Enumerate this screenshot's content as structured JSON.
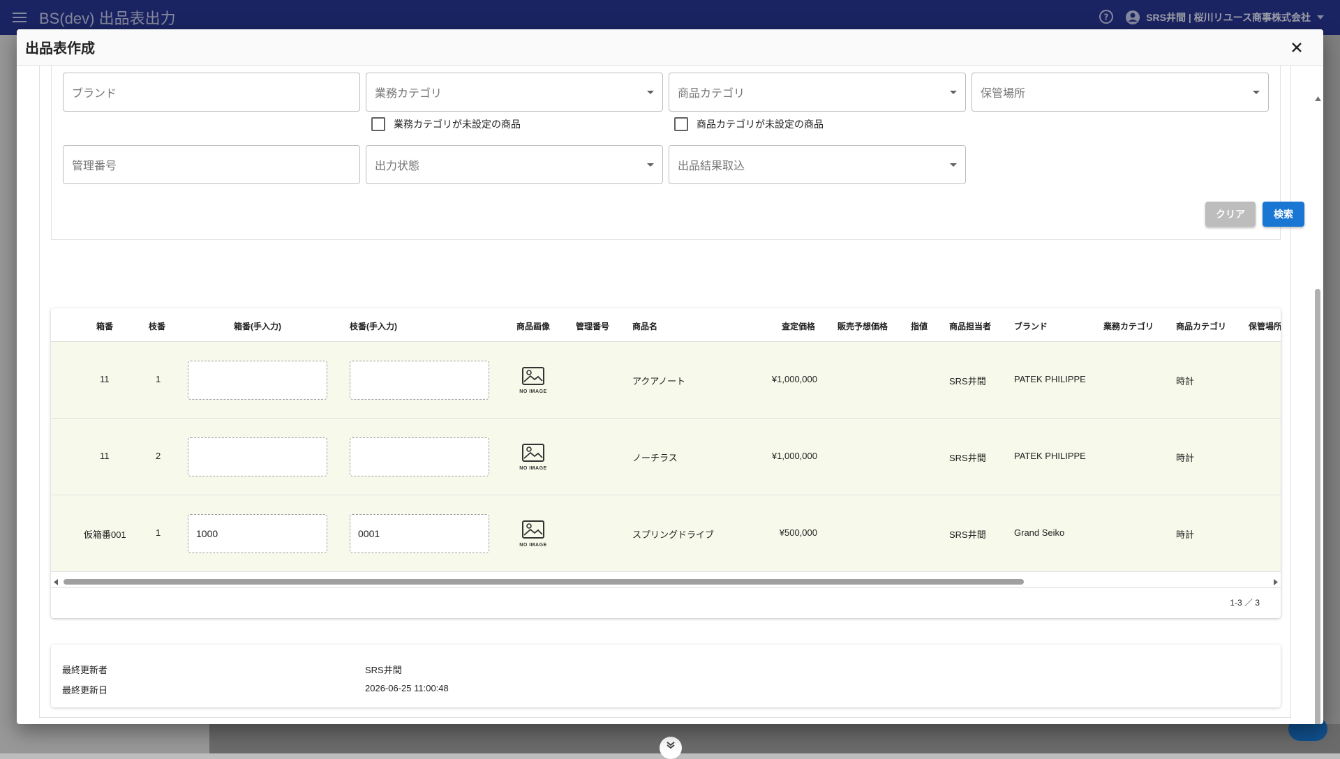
{
  "app": {
    "title": "BS(dev) 出品表出力",
    "user": "SRS井間 | 桜川リユース商事株式会社"
  },
  "dialog": {
    "title": "出品表作成",
    "filters": {
      "brand": "ブランド",
      "business_category": "業務カテゴリ",
      "product_category": "商品カテゴリ",
      "storage_location": "保管場所",
      "business_category_unset": "業務カテゴリが未設定の商品",
      "product_category_unset": "商品カテゴリが未設定の商品",
      "management_no": "管理番号",
      "output_status": "出力状態",
      "import_result": "出品結果取込"
    },
    "buttons": {
      "clear": "クリア",
      "search": "検索"
    },
    "table": {
      "headers": [
        "箱番",
        "枝番",
        "箱番(手入力)",
        "枝番(手入力)",
        "商品画像",
        "管理番号",
        "商品名",
        "査定価格",
        "販売予想価格",
        "指値",
        "商品担当者",
        "ブランド",
        "業務カテゴリ",
        "商品カテゴリ",
        "保管場所"
      ],
      "no_image_label": "NO IMAGE",
      "rows": [
        {
          "box": "11",
          "branch": "1",
          "box_input": "",
          "branch_input": "",
          "mgmt": "",
          "name": "アクアノート",
          "price": "¥1,000,000",
          "sale": "",
          "limit": "",
          "staff": "SRS井間",
          "brand": "PATEK PHILIPPE",
          "biz_cat": "",
          "cat": "時計"
        },
        {
          "box": "11",
          "branch": "2",
          "box_input": "",
          "branch_input": "",
          "mgmt": "",
          "name": "ノーチラス",
          "price": "¥1,000,000",
          "sale": "",
          "limit": "",
          "staff": "SRS井間",
          "brand": "PATEK PHILIPPE",
          "biz_cat": "",
          "cat": "時計"
        },
        {
          "box": "仮箱番001",
          "branch": "1",
          "box_input": "1000",
          "branch_input": "0001",
          "mgmt": "",
          "name": "スプリングドライブ",
          "price": "¥500,000",
          "sale": "",
          "limit": "",
          "staff": "SRS井間",
          "brand": "Grand Seiko",
          "biz_cat": "",
          "cat": "時計"
        }
      ],
      "pagination": "1-3 ／ 3"
    },
    "footer": {
      "updated_by_label": "最終更新者",
      "updated_by": "SRS井間",
      "updated_at_label": "最終更新日",
      "updated_at": "2026-06-25 11:00:48"
    }
  },
  "colors": {
    "appbar": "#283593",
    "primary": "#1976d2",
    "row_bg": "#f7f9ea"
  }
}
